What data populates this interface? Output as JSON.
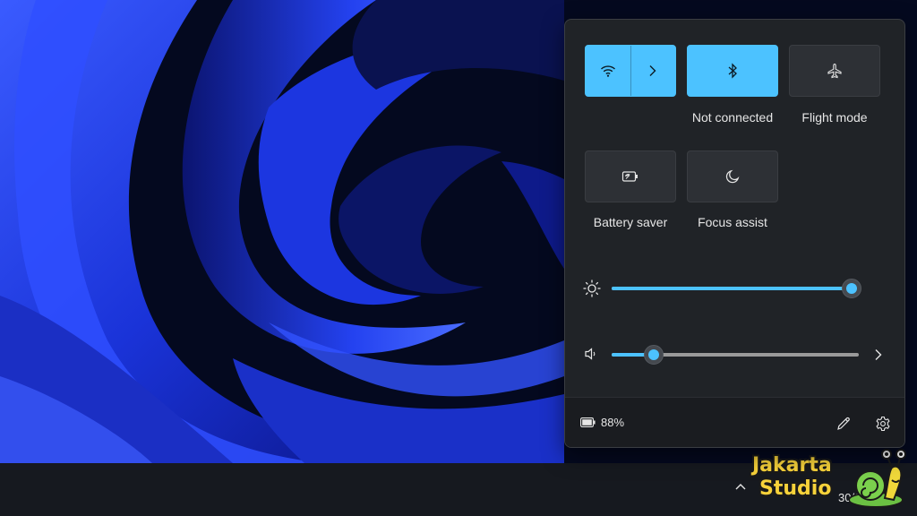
{
  "quick_settings": {
    "tiles": [
      {
        "label": "",
        "icon": "wifi-icon",
        "state": "on",
        "has_expand": true
      },
      {
        "label": "Not connected",
        "icon": "bluetooth-icon",
        "state": "on"
      },
      {
        "label": "Flight mode",
        "icon": "airplane-icon",
        "state": "off"
      },
      {
        "label": "Battery saver",
        "icon": "battery-saver-icon",
        "state": "off"
      },
      {
        "label": "Focus assist",
        "icon": "moon-icon",
        "state": "off"
      }
    ],
    "brightness": {
      "icon": "brightness-icon",
      "level": 0.97
    },
    "volume": {
      "icon": "speaker-icon",
      "level": 0.17
    },
    "footer": {
      "battery_percent": "88%",
      "battery_icon": "battery-icon",
      "edit_icon": "pencil-icon",
      "settings_icon": "gear-icon"
    }
  },
  "taskbar": {
    "date": "30/04/2022",
    "tray_icon": "chevron-up-icon"
  },
  "watermark": {
    "line1": "Jakarta",
    "line2": "Studio"
  },
  "colors": {
    "accent": "#4cc2ff",
    "flyout_bg": "#202327",
    "wallpaper_blue": "#1f3cf0"
  }
}
